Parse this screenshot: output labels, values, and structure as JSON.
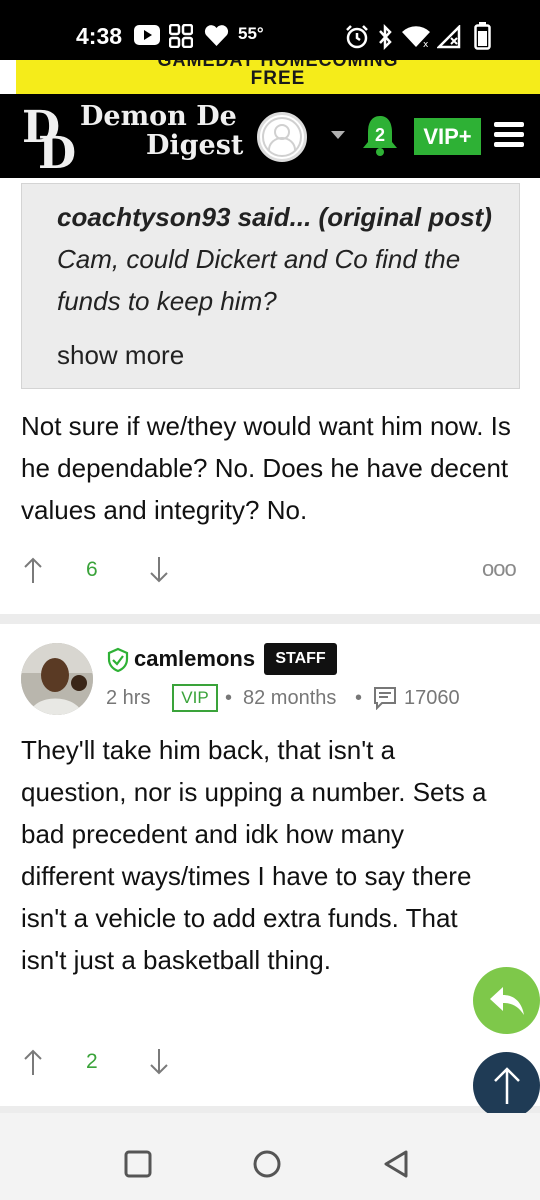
{
  "status_bar": {
    "time": "4:38",
    "temperature": "55°"
  },
  "ad": {
    "top_line": "GAMEDAY HOMECOMING",
    "bottom_line": "FREE"
  },
  "header": {
    "logo_line1": "Demon De",
    "logo_line2": "Digest",
    "notification_count": "2",
    "vip_label": "VIP+"
  },
  "quote": {
    "author_prefix": "coachtyson93 said... (original post)",
    "text": " Cam, could Dickert and Co find the funds to keep him?",
    "show_more": "show more"
  },
  "post1": {
    "body": "Not sure if we/they would want him now. Is he dependable? No. Does he have decent values and integrity? No.",
    "upvotes": "6",
    "more_label": "ooo"
  },
  "post2": {
    "username": "camlemons",
    "badge": "STAFF",
    "time": "2 hrs",
    "vip_tag": "VIP",
    "sep1": "•",
    "tenure": "82 months",
    "sep2": "•",
    "post_count": "17060",
    "body": "They'll take him back, that isn't a question, nor is upping a number. Sets a bad precedent and idk how many different ways/times I have to say there isn't a vehicle to add extra funds. That isn't just a basketball thing.",
    "upvotes": "2"
  },
  "colors": {
    "accent_green": "#2eb135",
    "ad_yellow": "#f5ec1a",
    "fab_green": "#7ec84a",
    "fab_navy": "#1f3b55"
  }
}
